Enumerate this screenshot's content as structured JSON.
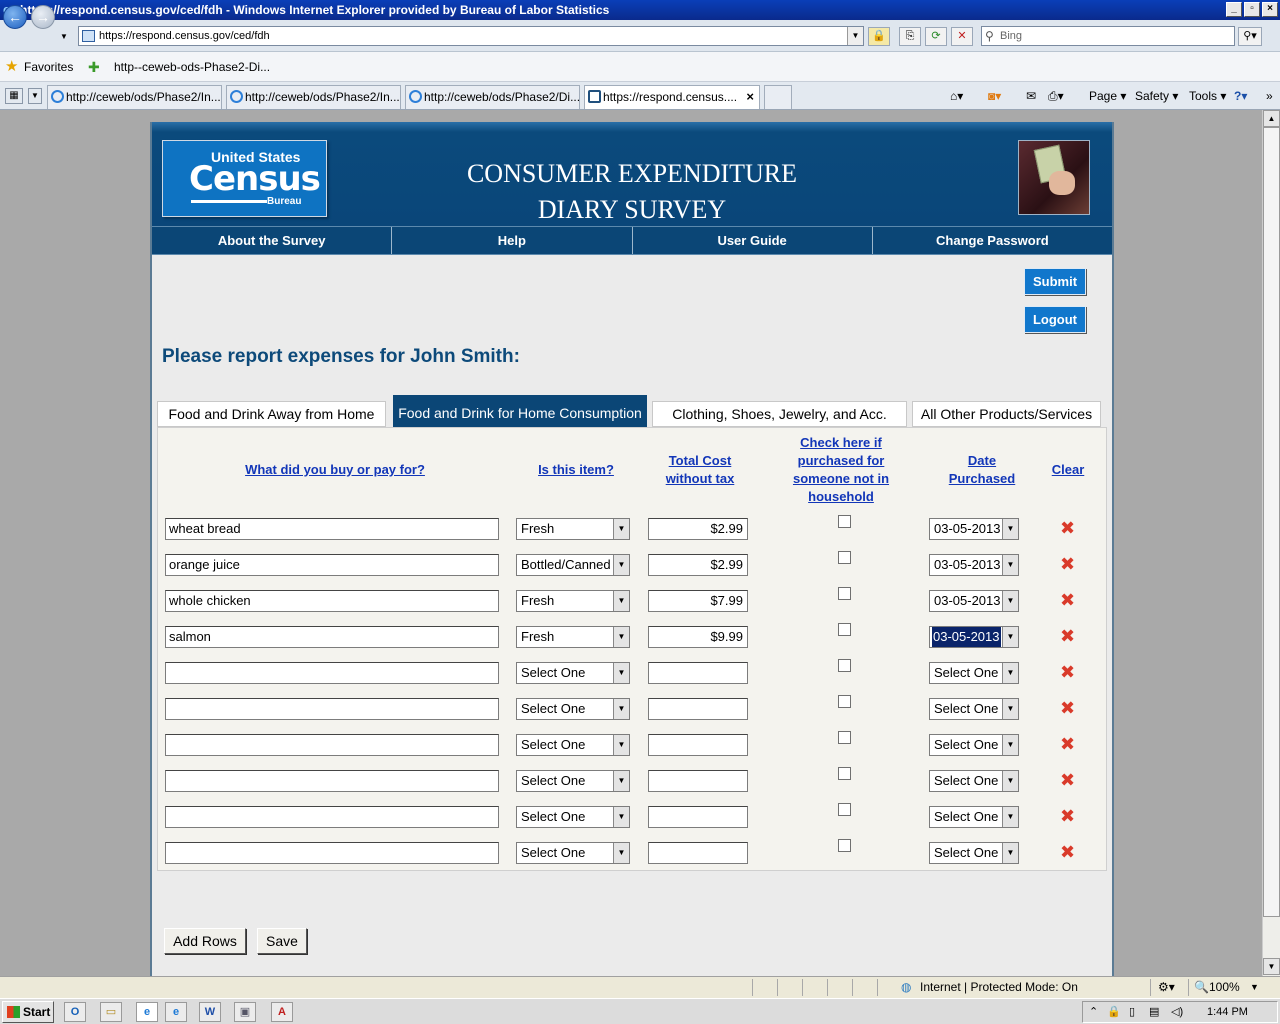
{
  "window": {
    "title": "https://respond.census.gov/ced/fdh - Windows Internet Explorer provided by Bureau of Labor Statistics",
    "address": "https://respond.census.gov/ced/fdh",
    "search_placeholder": "Bing"
  },
  "favorites": {
    "label": "Favorites",
    "item": "http--ceweb-ods-Phase2-Di..."
  },
  "browser_tabs": [
    {
      "label": "http://ceweb/ods/Phase2/In..."
    },
    {
      "label": "http://ceweb/ods/Phase2/In..."
    },
    {
      "label": "http://ceweb/ods/Phase2/Di..."
    },
    {
      "label": "https://respond.census...."
    }
  ],
  "command_bar": {
    "page": "Page",
    "safety": "Safety",
    "tools": "Tools"
  },
  "header": {
    "logo_top": "United States",
    "logo_main": "Census",
    "logo_bottom": "Bureau",
    "title_line1": "CONSUMER EXPENDITURE",
    "title_line2": "DIARY SURVEY"
  },
  "nav": [
    "About the Survey",
    "Help",
    "User Guide",
    "Change Password"
  ],
  "actions": {
    "submit": "Submit",
    "logout": "Logout"
  },
  "prompt": "Please report expenses for John Smith:",
  "category_tabs": [
    {
      "label": "Food and Drink Away from Home",
      "active": false
    },
    {
      "label": "Food and Drink for Home Consumption",
      "active": true
    },
    {
      "label": "Clothing, Shoes, Jewelry, and Acc.",
      "active": false
    },
    {
      "label": "All Other Products/Services",
      "active": false
    }
  ],
  "columns": {
    "item": "What did you buy or pay for?",
    "type": "Is this item?",
    "cost_l1": "Total Cost",
    "cost_l2": "without tax",
    "check_l1": "Check here if",
    "check_l2": "purchased for",
    "check_l3": "someone not in",
    "check_l4": "household",
    "date_l1": "Date",
    "date_l2": "Purchased",
    "clear": "Clear"
  },
  "rows": [
    {
      "item": "wheat bread",
      "type": "Fresh",
      "cost": "$2.99",
      "date": "03-05-2013"
    },
    {
      "item": "orange juice",
      "type": "Bottled/Canned",
      "cost": "$2.99",
      "date": "03-05-2013"
    },
    {
      "item": "whole chicken",
      "type": "Fresh",
      "cost": "$7.99",
      "date": "03-05-2013"
    },
    {
      "item": "salmon",
      "type": "Fresh",
      "cost": "$9.99",
      "date": "03-05-2013"
    },
    {
      "item": "",
      "type": "Select One",
      "cost": "",
      "date": "Select One"
    },
    {
      "item": "",
      "type": "Select One",
      "cost": "",
      "date": "Select One"
    },
    {
      "item": "",
      "type": "Select One",
      "cost": "",
      "date": "Select One"
    },
    {
      "item": "",
      "type": "Select One",
      "cost": "",
      "date": "Select One"
    },
    {
      "item": "",
      "type": "Select One",
      "cost": "",
      "date": "Select One"
    },
    {
      "item": "",
      "type": "Select One",
      "cost": "",
      "date": "Select One"
    }
  ],
  "bottom_buttons": {
    "add_rows": "Add Rows",
    "save": "Save"
  },
  "status": {
    "zone": "Internet | Protected Mode: On",
    "zoom": "100%"
  },
  "taskbar": {
    "start": "Start",
    "clock": "1:44 PM"
  },
  "colors": {
    "navy": "#0b4676",
    "census_blue": "#0e73c2",
    "link": "#1236b8",
    "clear_x": "#d93a2a"
  }
}
